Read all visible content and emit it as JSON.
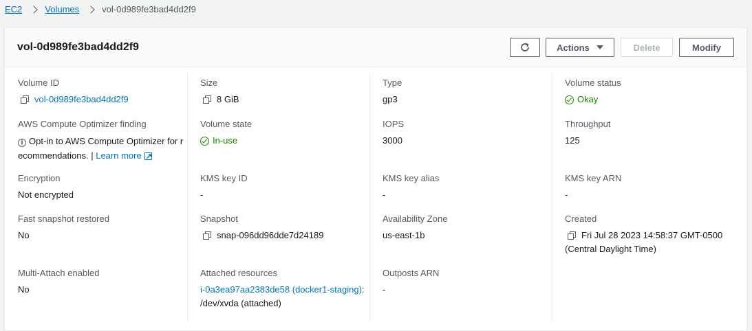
{
  "breadcrumb": {
    "ec2": "EC2",
    "volumes": "Volumes",
    "current": "vol-0d989fe3bad4dd2f9"
  },
  "header": {
    "title": "vol-0d989fe3bad4dd2f9",
    "actions_label": "Actions",
    "delete_label": "Delete",
    "modify_label": "Modify"
  },
  "details": {
    "volume_id": {
      "label": "Volume ID",
      "value": "vol-0d989fe3bad4dd2f9"
    },
    "size": {
      "label": "Size",
      "value": "8 GiB"
    },
    "type": {
      "label": "Type",
      "value": "gp3"
    },
    "volume_status": {
      "label": "Volume status",
      "value": "Okay"
    },
    "optimizer": {
      "label": "AWS Compute Optimizer finding",
      "text_line1": "Opt-in to AWS Compute Optimizer for r",
      "text_line2": "ecommendations. | ",
      "link": "Learn more"
    },
    "volume_state": {
      "label": "Volume state",
      "value": "In-use"
    },
    "iops": {
      "label": "IOPS",
      "value": "3000"
    },
    "throughput": {
      "label": "Throughput",
      "value": "125"
    },
    "encryption": {
      "label": "Encryption",
      "value": "Not encrypted"
    },
    "kms_key_id": {
      "label": "KMS key ID",
      "value": "-"
    },
    "kms_key_alias": {
      "label": "KMS key alias",
      "value": "-"
    },
    "kms_key_arn": {
      "label": "KMS key ARN",
      "value": "-"
    },
    "fast_snapshot": {
      "label": "Fast snapshot restored",
      "value": "No"
    },
    "snapshot": {
      "label": "Snapshot",
      "value": "snap-096dd96dde7d24189"
    },
    "availability_zone": {
      "label": "Availability Zone",
      "value": "us-east-1b"
    },
    "created": {
      "label": "Created",
      "line1": "Fri Jul 28 2023 14:58:37 GMT-0500",
      "line2": "(Central Daylight Time)"
    },
    "multi_attach": {
      "label": "Multi-Attach enabled",
      "value": "No"
    },
    "attached": {
      "label": "Attached resources",
      "link": "i-0a3ea97aa2383de58 (docker1-staging)",
      "suffix": ":",
      "line2": "/dev/xvda (attached)"
    },
    "outposts_arn": {
      "label": "Outposts ARN",
      "value": "-"
    }
  },
  "colors": {
    "link": "#0073bb",
    "success": "#1d8102",
    "text": "#16191f",
    "label": "#545b64"
  },
  "icons": [
    "chevron-right-icon",
    "refresh-icon",
    "caret-down-icon",
    "copy-icon",
    "status-positive-icon",
    "info-icon",
    "external-link-icon"
  ]
}
